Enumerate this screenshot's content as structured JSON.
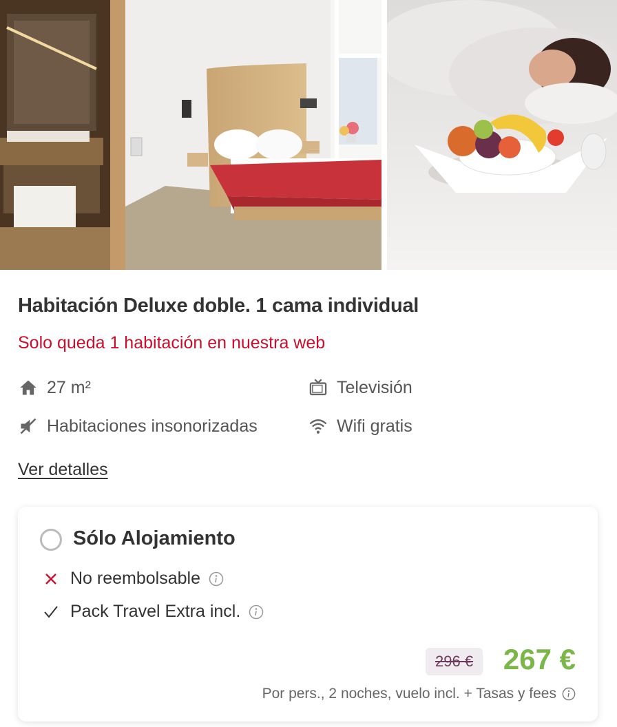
{
  "gallery": {
    "photos": [
      {
        "alt": "bedroom-with-bathroom-photo"
      },
      {
        "alt": "breakfast-fruit-bowl-photo"
      }
    ]
  },
  "room": {
    "title": "Habitación Deluxe doble. 1 cama individual",
    "availability": "Solo queda 1 habitación en nuestra web",
    "availability_color": "#c8102e",
    "amenities": [
      {
        "icon": "house-icon",
        "label": "27 m²"
      },
      {
        "icon": "tv-icon",
        "label": "Televisión"
      },
      {
        "icon": "soundproof-icon",
        "label": "Habitaciones insonorizadas"
      },
      {
        "icon": "wifi-icon",
        "label": "Wifi gratis"
      }
    ],
    "details_link": "Ver detalles"
  },
  "rate": {
    "title": "Sólo Alojamiento",
    "conditions": [
      {
        "icon": "cross-icon",
        "label": "No reembolsable",
        "color": "#c8102e"
      },
      {
        "icon": "check-icon",
        "label": "Pack Travel Extra incl.",
        "color": "#333333"
      }
    ],
    "old_price": "296 €",
    "price": "267 €",
    "price_color": "#7ab648",
    "price_note": "Por pers., 2 noches, vuelo incl. + Tasas y fees"
  }
}
